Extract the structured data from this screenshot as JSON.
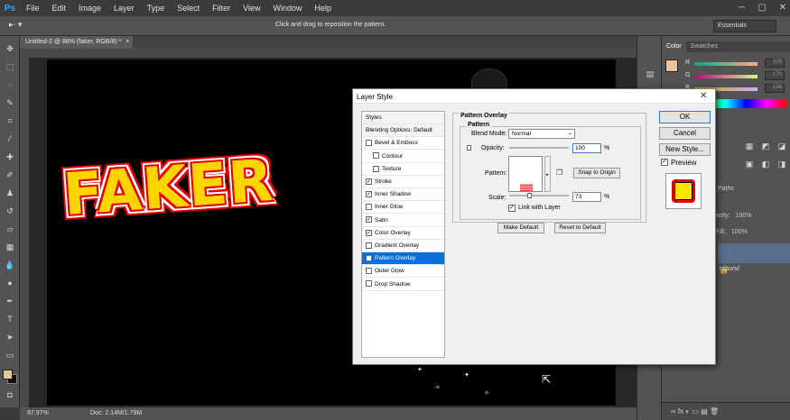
{
  "app": {
    "logo": "Ps"
  },
  "menu": [
    "File",
    "Edit",
    "Image",
    "Layer",
    "Type",
    "Select",
    "Filter",
    "View",
    "Window",
    "Help"
  ],
  "window_controls": [
    "─",
    "▢",
    "✕"
  ],
  "options_bar": {
    "hint": "Click and drag to reposition the pattern.",
    "workspace": "Essentials",
    "tool_preset": "▸⋅ ▾"
  },
  "document_tab": {
    "title": "Untitled-2 @ 88% (faker, RGB/8) *",
    "close": "×"
  },
  "canvas": {
    "text": "FAKER"
  },
  "status_bar": {
    "zoom": "87.97%",
    "doc": "Doc: 2.14M/1.79M"
  },
  "panels": {
    "color_tabs": [
      "Color",
      "Swatches"
    ],
    "rows": [
      {
        "label": "R",
        "value": "205"
      },
      {
        "label": "G",
        "value": "170"
      },
      {
        "label": "B",
        "value": "138"
      }
    ],
    "layers_tabs": "Paths",
    "opacity_label": "Opacity:",
    "opacity_value": "100%",
    "fill_label": "Fill:",
    "fill_value": "100%",
    "background_layer": "ground",
    "footer_icons": "∞ fx ◐ ▭ ▤ 🗑"
  },
  "dialog": {
    "title": "Layer Style",
    "close": "✕",
    "styles": [
      {
        "label": "Styles",
        "type": "header"
      },
      {
        "label": "Blending Options: Default",
        "type": "header"
      },
      {
        "label": "Bevel & Emboss",
        "checked": false
      },
      {
        "label": "Contour",
        "checked": false,
        "sub": true
      },
      {
        "label": "Texture",
        "checked": false,
        "sub": true
      },
      {
        "label": "Stroke",
        "checked": true
      },
      {
        "label": "Inner Shadow",
        "checked": true
      },
      {
        "label": "Inner Glow",
        "checked": false
      },
      {
        "label": "Satin",
        "checked": true
      },
      {
        "label": "Color Overlay",
        "checked": true
      },
      {
        "label": "Gradient Overlay",
        "checked": false
      },
      {
        "label": "Pattern Overlay",
        "checked": true,
        "selected": true
      },
      {
        "label": "Outer Glow",
        "checked": false
      },
      {
        "label": "Drop Shadow",
        "checked": false
      }
    ],
    "section_title": "Pattern Overlay",
    "group_title": "Pattern",
    "blend_label": "Blend Mode:",
    "blend_value": "Normal",
    "opacity_label": "Opacity:",
    "opacity_value": "100",
    "opacity_pct": 100,
    "percent": "%",
    "pattern_label": "Pattern:",
    "snap_label": "Snap to Origin",
    "scale_label": "Scale:",
    "scale_value": "73",
    "link_label": "Link with Layer",
    "make_default": "Make Default",
    "reset_default": "Reset to Default",
    "ok": "OK",
    "cancel": "Cancel",
    "new_style": "New Style...",
    "preview": "Preview"
  },
  "colors": {
    "foreground": "#e8c3a0",
    "selection": "#0a6fd8",
    "text_fill": "#ffd400",
    "text_stroke": "#e60000"
  }
}
